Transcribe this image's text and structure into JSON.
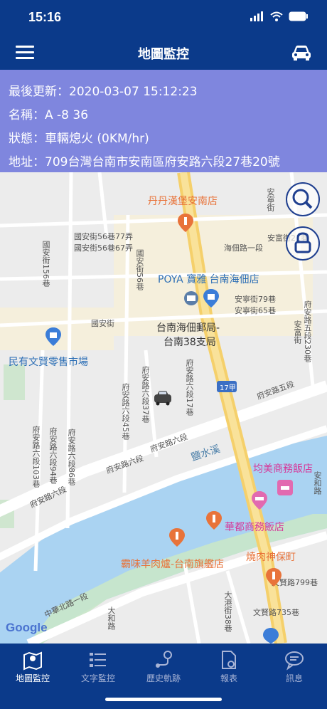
{
  "status_bar": {
    "time": "15:16"
  },
  "header": {
    "title": "地圖監控"
  },
  "info": {
    "updated": "最後更新：2020-03-07 15:12:23",
    "name": "名稱：A -8 36",
    "state": "狀態：車輛熄火 (0KM/hr)",
    "address": "地址：709台灣台南市安南區府安路六段27巷20號"
  },
  "map": {
    "pois": {
      "p1": "丹丹漢堡安南店",
      "p2": "POYA 寶雅 台南海佃店",
      "p3": "台南海佃郵局-",
      "p3b": "台南38支局",
      "p4": "民有文賢零售市場",
      "p5": "均美商務飯店",
      "p6": "華都商務飯店",
      "p7": "燒肉神保町",
      "p8": "霸味羊肉爐-台南旗艦店",
      "river": "鹽水溪"
    },
    "streets": {
      "s1": "國安街",
      "s2": "府安路五段",
      "s3": "府安路六段",
      "s4": "府安路六段",
      "s5": "府安路六段",
      "s6": "中華北路一段",
      "s7": "海佃路一段",
      "s8": "國安街56巷77弄",
      "s9": "國安街56巷67弄",
      "s10": "安寧街79巷",
      "s11": "安寧街65巷",
      "s12": "安富街21巷",
      "s13": "府安路五段230巷",
      "s14": "國安街156巷",
      "s15": "國安街56巷",
      "s16": "府安路六段37巷",
      "s17": "府安路六段45巷",
      "s18": "府安路六段17巷",
      "s19": "府安路六段103巷",
      "s20": "府安路六段94巷",
      "s21": "府安路六段86巷",
      "s22": "文賢路799巷",
      "s23": "文賢路735巷",
      "s24": "大港街38巷",
      "s25": "大和路",
      "s26": "安寧街",
      "s27": "安富街",
      "s28": "安和路",
      "road_badge": "17甲"
    },
    "logo": "Google"
  },
  "tabs": [
    {
      "label": "地圖監控",
      "icon": "map-pin-icon",
      "active": true
    },
    {
      "label": "文字監控",
      "icon": "list-icon",
      "active": false
    },
    {
      "label": "歷史軌跡",
      "icon": "route-icon",
      "active": false
    },
    {
      "label": "報表",
      "icon": "report-icon",
      "active": false
    },
    {
      "label": "訊息",
      "icon": "message-icon",
      "active": false
    }
  ]
}
